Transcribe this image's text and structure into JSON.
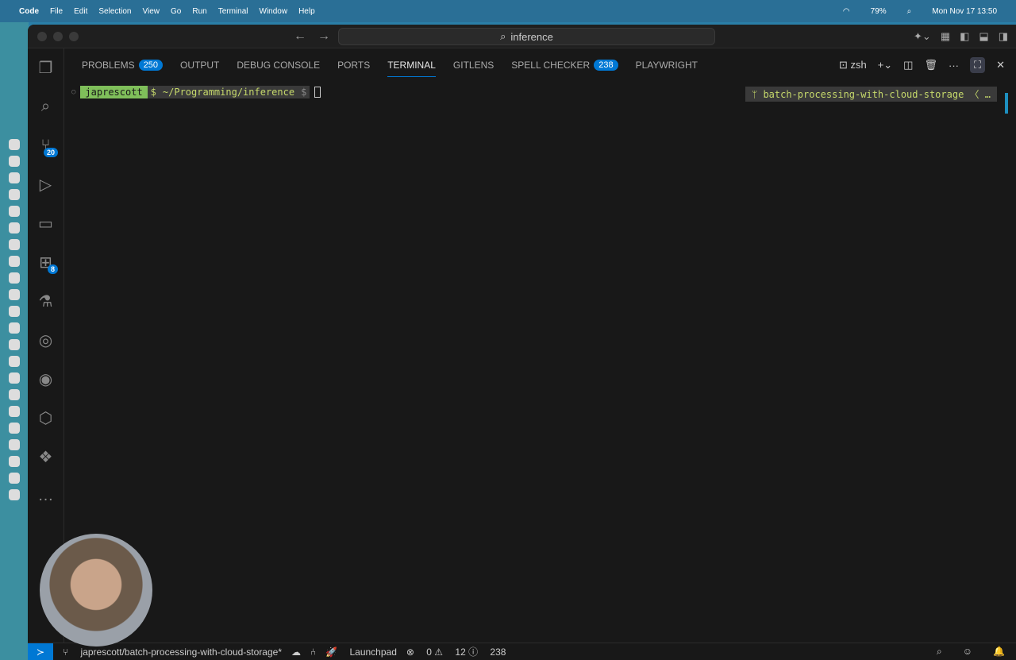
{
  "menubar": {
    "app": "Code",
    "items": [
      "File",
      "Edit",
      "Selection",
      "View",
      "Go",
      "Run",
      "Terminal",
      "Window",
      "Help"
    ],
    "battery": "79%",
    "datetime": "Mon Nov 17  13:50"
  },
  "titlebar": {
    "search": "inference"
  },
  "activity": {
    "source_control_badge": "20",
    "extensions_badge": "8"
  },
  "panel": {
    "tabs": [
      {
        "label": "PROBLEMS",
        "count": "250"
      },
      {
        "label": "OUTPUT"
      },
      {
        "label": "DEBUG CONSOLE"
      },
      {
        "label": "PORTS"
      },
      {
        "label": "TERMINAL"
      },
      {
        "label": "GITLENS"
      },
      {
        "label": "SPELL CHECKER",
        "count": "238"
      },
      {
        "label": "PLAYWRIGHT"
      }
    ],
    "shell": "zsh"
  },
  "terminal": {
    "user": "japrescott",
    "dollar": "$",
    "path": "~/Programming/inference",
    "prompt": "$",
    "branch": "batch-processing-with-cloud-storage",
    "branch_suffix": "〈 …"
  },
  "status": {
    "branch": "japrescott/batch-processing-with-cloud-storage*",
    "launchpad": "Launchpad",
    "errors": "0",
    "warnings": "12",
    "info": "238"
  }
}
